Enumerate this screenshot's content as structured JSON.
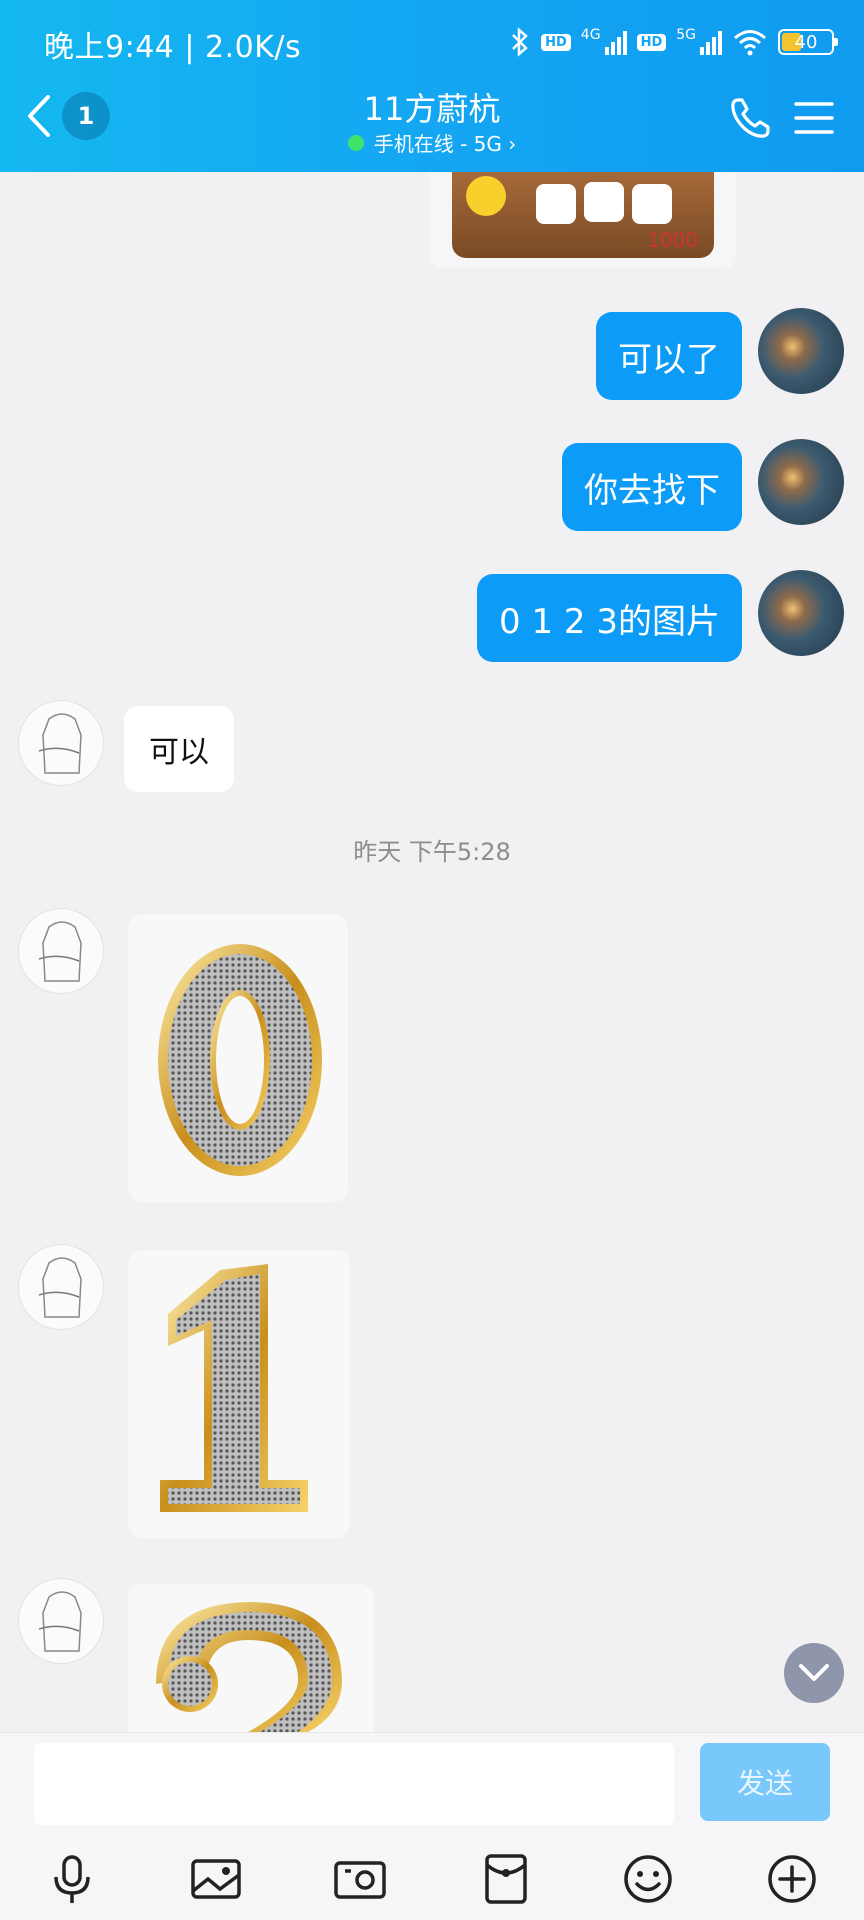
{
  "status_bar": {
    "time_speed": "晚上9:44 | 2.0K/s",
    "hd": "HD",
    "net1": "4G",
    "net2": "5G",
    "battery": "40"
  },
  "header": {
    "back_count": "1",
    "title": "11方蔚杭",
    "subtitle": "手机在线 - 5G ›"
  },
  "messages": {
    "m1": "可以了",
    "m2": "你去找下",
    "m3": "0 1 2 3的图片",
    "r1": "可以",
    "timestamp": "昨天 下午5:28",
    "prev_card_amount": "1000"
  },
  "stickers": [
    "0",
    "1",
    "2"
  ],
  "input": {
    "placeholder": "",
    "send_label": "发送"
  },
  "icons": {
    "back": "chevron-left-icon",
    "call": "phone-icon",
    "menu": "menu-icon",
    "voice": "microphone-icon",
    "image": "image-icon",
    "camera": "camera-icon",
    "red_packet": "red-packet-icon",
    "emoji": "smiley-icon",
    "more": "plus-icon",
    "scroll": "chevron-down-icon"
  },
  "colors": {
    "accent": "#0d9bf8",
    "header": "#14a6f2",
    "send_disabled": "#79c8fb"
  }
}
